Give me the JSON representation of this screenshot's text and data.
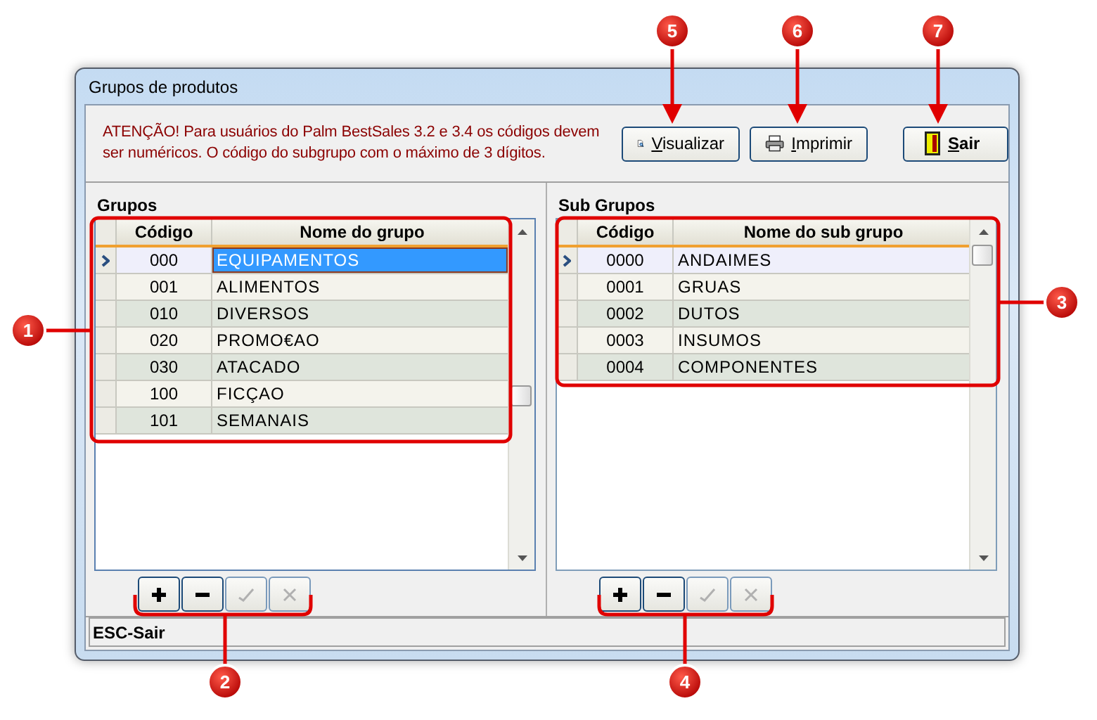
{
  "window": {
    "title": "Grupos de produtos"
  },
  "notice": "ATENÇÃO! Para usuários do Palm BestSales 3.2 e 3.4 os códigos devem ser numéricos. O código do subgrupo com o máximo de 3 dígitos.",
  "toolbar": [
    {
      "label": "Visualizar",
      "kind": "preview"
    },
    {
      "label": "Imprimir",
      "kind": "print"
    },
    {
      "label": "Sair",
      "kind": "exit"
    }
  ],
  "panels": [
    {
      "title": "Grupos",
      "focused": true,
      "columns": [
        "Código",
        "Nome do grupo"
      ],
      "rows": [
        {
          "code": "000",
          "name": "EQUIPAMENTOS",
          "selected": true
        },
        {
          "code": "001",
          "name": "ALIMENTOS",
          "selected": false
        },
        {
          "code": "010",
          "name": "DIVERSOS",
          "selected": false
        },
        {
          "code": "020",
          "name": "PROMO€AO",
          "selected": false
        },
        {
          "code": "030",
          "name": "ATACADO",
          "selected": false
        },
        {
          "code": "100",
          "name": "FICÇAO",
          "selected": false
        },
        {
          "code": "101",
          "name": "SEMANAIS",
          "selected": false
        }
      ],
      "navigator": [
        {
          "kind": "add",
          "disabled": false
        },
        {
          "kind": "delete",
          "disabled": false
        },
        {
          "kind": "post",
          "disabled": true
        },
        {
          "kind": "cancel",
          "disabled": true
        }
      ]
    },
    {
      "title": "Sub Grupos",
      "focused": false,
      "columns": [
        "Código",
        "Nome do sub grupo"
      ],
      "rows": [
        {
          "code": "0000",
          "name": "ANDAIMES",
          "selected": true
        },
        {
          "code": "0001",
          "name": "GRUAS",
          "selected": false
        },
        {
          "code": "0002",
          "name": "DUTOS",
          "selected": false
        },
        {
          "code": "0003",
          "name": "INSUMOS",
          "selected": false
        },
        {
          "code": "0004",
          "name": "COMPONENTES",
          "selected": false
        }
      ],
      "navigator": [
        {
          "kind": "add",
          "disabled": false
        },
        {
          "kind": "delete",
          "disabled": false
        },
        {
          "kind": "post",
          "disabled": true
        },
        {
          "kind": "cancel",
          "disabled": true
        }
      ]
    }
  ],
  "status_bar": "ESC-Sair",
  "callouts": [
    {
      "number": "1"
    },
    {
      "number": "2"
    },
    {
      "number": "3"
    },
    {
      "number": "4"
    },
    {
      "number": "5"
    },
    {
      "number": "6"
    },
    {
      "number": "7"
    }
  ]
}
